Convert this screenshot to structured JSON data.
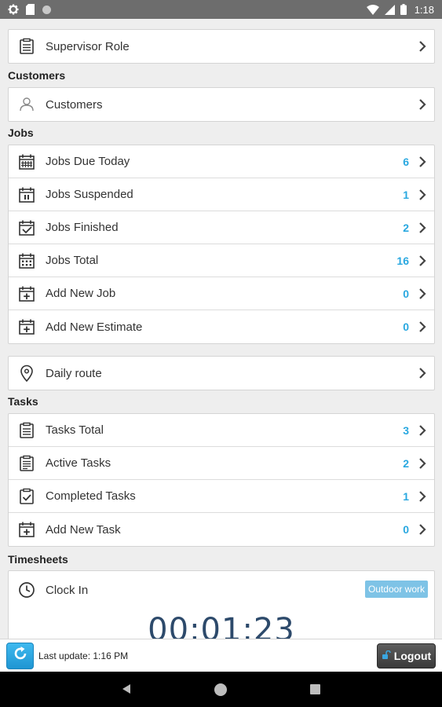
{
  "status_bar": {
    "time": "1:18",
    "left_icons": [
      "settings-icon",
      "sd-card-icon",
      "circle-icon"
    ],
    "right_icons": [
      "wifi-icon",
      "signal-icon",
      "battery-icon"
    ]
  },
  "supervisor": {
    "label": "Supervisor Role"
  },
  "sections": {
    "customers": "Customers",
    "jobs": "Jobs",
    "tasks": "Tasks",
    "timesheets": "Timesheets"
  },
  "customers": {
    "label": "Customers"
  },
  "jobs": [
    {
      "label": "Jobs Due Today",
      "count": "6",
      "icon": "calendar-grid-icon"
    },
    {
      "label": "Jobs Suspended",
      "count": "1",
      "icon": "calendar-pause-icon"
    },
    {
      "label": "Jobs Finished",
      "count": "2",
      "icon": "calendar-check-icon"
    },
    {
      "label": "Jobs Total",
      "count": "16",
      "icon": "calendar-dots-icon"
    },
    {
      "label": "Add New Job",
      "count": "0",
      "icon": "calendar-plus-icon"
    },
    {
      "label": "Add New Estimate",
      "count": "0",
      "icon": "calendar-plus-icon"
    }
  ],
  "daily_route": {
    "label": "Daily route"
  },
  "tasks": [
    {
      "label": "Tasks Total",
      "count": "3",
      "icon": "list-icon"
    },
    {
      "label": "Active Tasks",
      "count": "2",
      "icon": "clipboard-icon"
    },
    {
      "label": "Completed Tasks",
      "count": "1",
      "icon": "clipboard-check-icon"
    },
    {
      "label": "Add New Task",
      "count": "0",
      "icon": "calendar-plus-icon"
    }
  ],
  "timesheet": {
    "label": "Clock In",
    "badge": "Outdoor work",
    "timer": "00:01:23"
  },
  "bottom": {
    "last_update": "Last update: 1:16 PM",
    "logout": "Logout"
  },
  "colors": {
    "accent": "#29a8e0",
    "status_bar": "#6d6d6d",
    "badge": "#7ec3e6"
  }
}
